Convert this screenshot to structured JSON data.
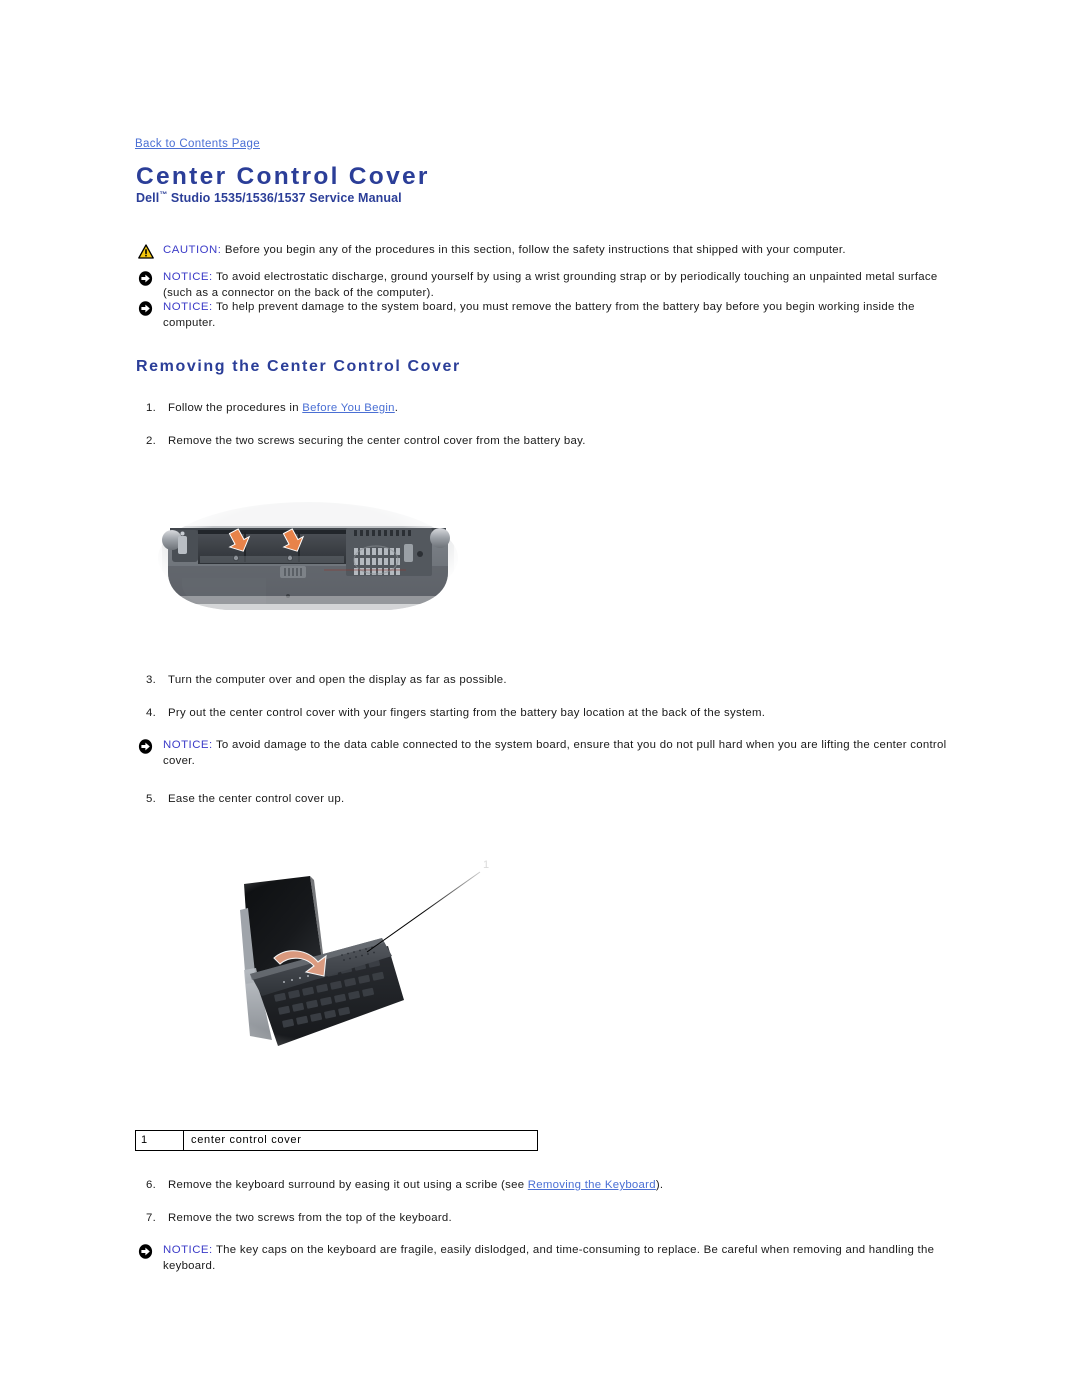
{
  "nav": {
    "back_link": "Back to Contents Page"
  },
  "header": {
    "title": "Center Control Cover",
    "brand": "Dell",
    "tm": "™",
    "subtitle_rest": " Studio 1535/1536/1537 Service Manual",
    "title_color": "#2b3e98",
    "link_color": "#4a6fd4"
  },
  "admonitions": [
    {
      "type": "caution",
      "icon": "warning-triangle-icon",
      "label": "CAUTION:",
      "text": " Before you begin any of the procedures in this section, follow the safety instructions that shipped with your computer."
    },
    {
      "type": "notice",
      "icon": "notice-circle-arrow-icon",
      "label": "NOTICE:",
      "text": " To avoid electrostatic discharge, ground yourself by using a wrist grounding strap or by periodically touching an unpainted metal surface (such as a connector on the back of the computer)."
    },
    {
      "type": "notice",
      "icon": "notice-circle-arrow-icon",
      "label": "NOTICE:",
      "text": " To help prevent damage to the system board, you must remove the battery from the battery bay before you begin working inside the computer."
    },
    {
      "type": "notice",
      "icon": "notice-circle-arrow-icon",
      "label": "NOTICE:",
      "text": " To avoid damage to the data cable connected to the system board, ensure that you do not pull hard when you are lifting the center control cover."
    },
    {
      "type": "notice",
      "icon": "notice-circle-arrow-icon",
      "label": "NOTICE:",
      "text": " The key caps on the keyboard are fragile, easily dislodged, and time-consuming to replace. Be careful when removing and handling the keyboard."
    }
  ],
  "section": {
    "heading": "Removing the Center Control Cover"
  },
  "steps": [
    {
      "num": "1.",
      "pre": "Follow the procedures in ",
      "link": "Before You Begin",
      "post": "."
    },
    {
      "num": "2.",
      "pre": "Remove the two screws securing the center control cover from the battery bay.",
      "link": "",
      "post": ""
    },
    {
      "num": "3.",
      "pre": "Turn the computer over and open the display as far as possible.",
      "link": "",
      "post": ""
    },
    {
      "num": "4.",
      "pre": "Pry out the center control cover with your fingers starting from the battery bay location at the back of the system.",
      "link": "",
      "post": ""
    },
    {
      "num": "5.",
      "pre": "Ease the center control cover up.",
      "link": "",
      "post": ""
    },
    {
      "num": "6.",
      "pre": "Remove the keyboard surround by easing it out using a scribe (see ",
      "link": "Removing the Keyboard",
      "post": ")."
    },
    {
      "num": "7.",
      "pre": "Remove the two screws from the top of the keyboard.",
      "link": "",
      "post": ""
    }
  ],
  "figures": [
    {
      "name": "laptop-bottom-battery-bay-photo",
      "callouts": []
    },
    {
      "name": "laptop-center-control-cover-photo",
      "callouts": [
        {
          "number": "1"
        }
      ]
    }
  ],
  "legend": {
    "rows": [
      {
        "number": "1",
        "label": "center control cover"
      }
    ]
  }
}
